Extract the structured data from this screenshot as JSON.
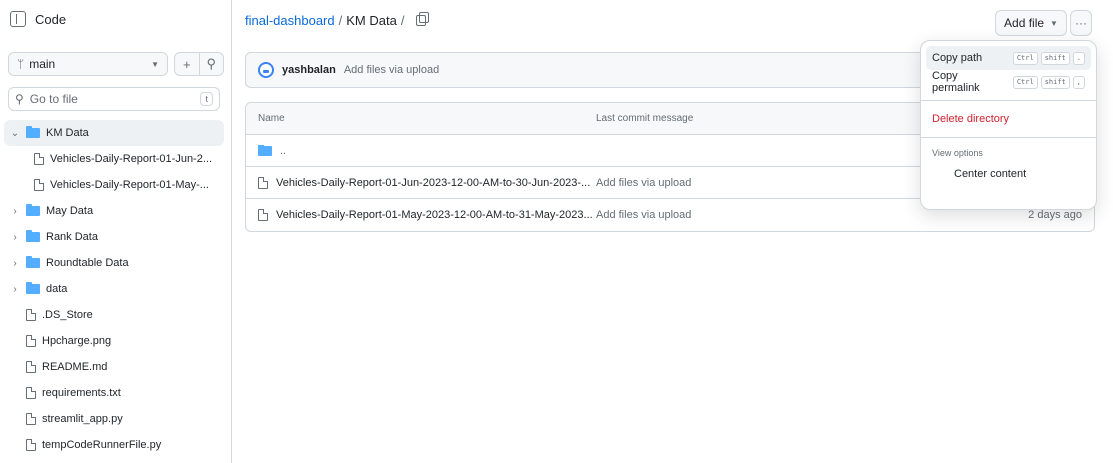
{
  "sidebar": {
    "title": "Code",
    "branch": "main",
    "goto_placeholder": "Go to file",
    "goto_key": "t",
    "tree": [
      {
        "label": "KM Data",
        "type": "folder",
        "expanded": true,
        "selected": true,
        "depth": 0
      },
      {
        "label": "Vehicles-Daily-Report-01-Jun-2...",
        "type": "file",
        "depth": 1
      },
      {
        "label": "Vehicles-Daily-Report-01-May-...",
        "type": "file",
        "depth": 1
      },
      {
        "label": "May Data",
        "type": "folder",
        "depth": 0
      },
      {
        "label": "Rank Data",
        "type": "folder",
        "depth": 0
      },
      {
        "label": "Roundtable Data",
        "type": "folder",
        "depth": 0
      },
      {
        "label": "data",
        "type": "folder",
        "depth": 0
      },
      {
        "label": ".DS_Store",
        "type": "file",
        "depth": 0
      },
      {
        "label": "Hpcharge.png",
        "type": "file",
        "depth": 0
      },
      {
        "label": "README.md",
        "type": "file",
        "depth": 0
      },
      {
        "label": "requirements.txt",
        "type": "file",
        "depth": 0
      },
      {
        "label": "streamlit_app.py",
        "type": "file",
        "depth": 0
      },
      {
        "label": "tempCodeRunnerFile.py",
        "type": "file",
        "depth": 0
      }
    ]
  },
  "breadcrumb": {
    "repo": "final-dashboard",
    "sep1": "/",
    "folder": "KM Data",
    "sep2": "/"
  },
  "toolbar": {
    "add_file": "Add file",
    "more": "···"
  },
  "commit": {
    "author": "yashbalan",
    "message": "Add files via upload"
  },
  "table": {
    "headers": {
      "name": "Name",
      "message": "Last commit message",
      "date": ""
    },
    "parent": "..",
    "rows": [
      {
        "name": "Vehicles-Daily-Report-01-Jun-2023-12-00-AM-to-30-Jun-2023-...",
        "message": "Add files via upload",
        "date": ""
      },
      {
        "name": "Vehicles-Daily-Report-01-May-2023-12-00-AM-to-31-May-2023...",
        "message": "Add files via upload",
        "date": "2 days ago"
      }
    ]
  },
  "menu": {
    "copy_path": "Copy path",
    "copy_path_keys": [
      "Ctrl",
      "shift",
      "."
    ],
    "copy_permalink": "Copy permalink",
    "copy_permalink_keys": [
      "Ctrl",
      "shift",
      ","
    ],
    "delete_directory": "Delete directory",
    "view_options": "View options",
    "center_content": "Center content"
  },
  "colors": {
    "accent": "#0969da",
    "folder": "#54aeff",
    "danger": "#cf222e"
  }
}
